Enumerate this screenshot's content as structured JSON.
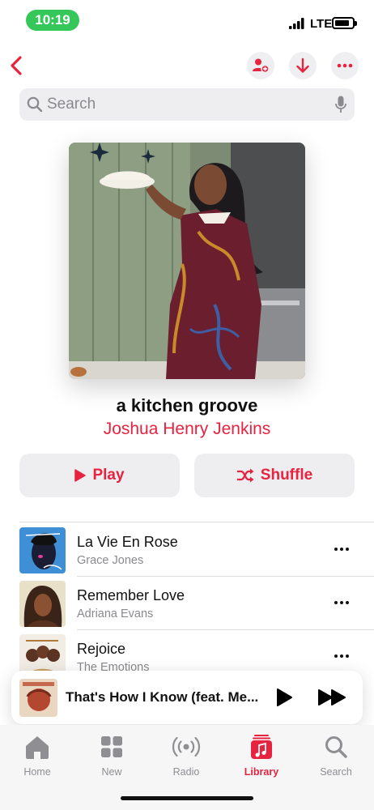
{
  "status_bar": {
    "time": "10:19",
    "network": "LTE"
  },
  "search": {
    "placeholder": "Search"
  },
  "playlist": {
    "title": "a kitchen groove",
    "curator": "Joshua Henry Jenkins"
  },
  "actions": {
    "play_label": "Play",
    "shuffle_label": "Shuffle"
  },
  "tracks": [
    {
      "title": "La Vie En Rose",
      "artist": "Grace Jones"
    },
    {
      "title": "Remember Love",
      "artist": "Adriana Evans"
    },
    {
      "title": "Rejoice",
      "artist": "The Emotions"
    }
  ],
  "now_playing": {
    "title": "That's How I Know (feat. Me..."
  },
  "tabs": [
    {
      "label": "Home",
      "icon": "house-icon"
    },
    {
      "label": "New",
      "icon": "grid-icon"
    },
    {
      "label": "Radio",
      "icon": "radio-icon"
    },
    {
      "label": "Library",
      "icon": "music-note-icon",
      "active": true
    },
    {
      "label": "Search",
      "icon": "search-icon"
    }
  ],
  "colors": {
    "accent": "#e8233f",
    "status_pill": "#35c759"
  }
}
